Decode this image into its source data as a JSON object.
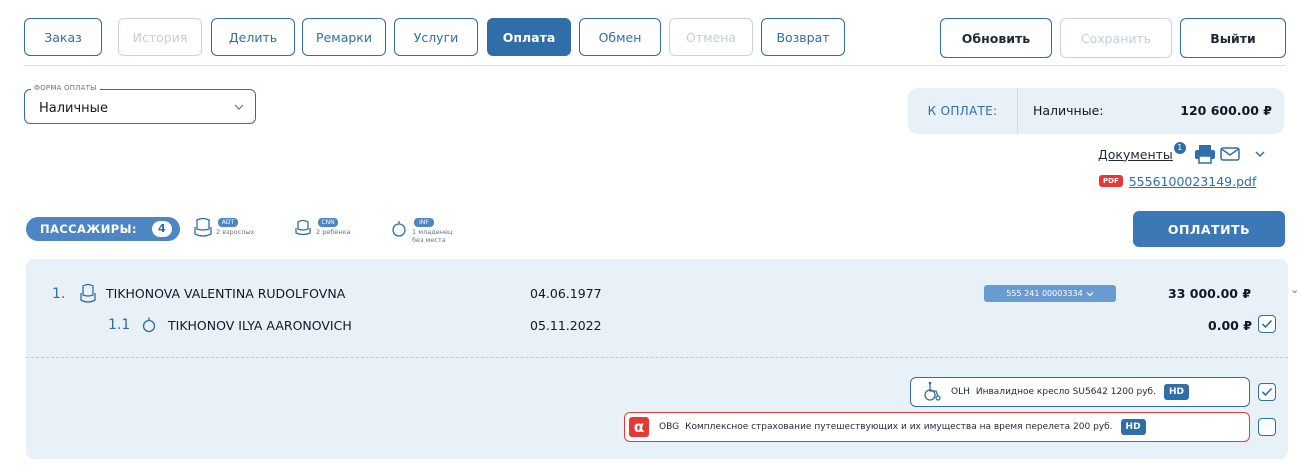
{
  "tabs": [
    {
      "label": "Заказ",
      "state": "normal"
    },
    {
      "label": "История",
      "state": "disabled"
    },
    {
      "label": "Делить",
      "state": "normal"
    },
    {
      "label": "Ремарки",
      "state": "normal"
    },
    {
      "label": "Услуги",
      "state": "normal"
    },
    {
      "label": "Оплата",
      "state": "active"
    },
    {
      "label": "Обмен",
      "state": "normal"
    },
    {
      "label": "Отмена",
      "state": "disabled"
    },
    {
      "label": "Возврат",
      "state": "normal"
    }
  ],
  "actions": {
    "refresh": "Обновить",
    "save": "Сохранить",
    "exit": "Выйти"
  },
  "payment_form": {
    "legend": "ФОРМА ОПЛАТЫ",
    "value": "Наличные"
  },
  "to_pay": {
    "label": "К ОПЛАТЕ:",
    "method": "Наличные:",
    "amount": "120 600.00 ₽"
  },
  "documents": {
    "label": "Документы",
    "count": "1",
    "pdf_tag": "PDF",
    "file": "5556100023149.pdf"
  },
  "passengers_bar": {
    "label": "ПАССАЖИРЫ:",
    "count": "4",
    "types": [
      {
        "tag": "ADT",
        "desc": "2 взрослых",
        "desc2": ""
      },
      {
        "tag": "CNN",
        "desc": "2 ребенка",
        "desc2": ""
      },
      {
        "tag": "INF",
        "desc": "1 младенец",
        "desc2": "без места"
      }
    ]
  },
  "pay_button": "ОПЛАТИТЬ",
  "passengers": [
    {
      "num": "1.",
      "name": "TIKHONOVA VALENTINA RUDOLFOVNA",
      "dob": "04.06.1977",
      "ticket": "555 241 00003334",
      "amount": "33 000.00 ₽",
      "checked": false
    },
    {
      "num": "1.1",
      "name": "TIKHONOV ILYA AARONOVICH",
      "dob": "05.11.2022",
      "amount": "0.00 ₽",
      "checked": true
    }
  ],
  "services": [
    {
      "code": "OLH",
      "text": "Инвалидное кресло  SU5642  1200 руб.",
      "badge": "HD",
      "checked": true
    },
    {
      "code": "OBG",
      "text": "Комплексное страхование путешествующих и их имущества на время перелета  200 руб.",
      "badge": "HD",
      "checked": false
    }
  ],
  "colors": {
    "accent": "#2f6ea6",
    "panel_bg": "#e8f0f8",
    "alfa_red": "#e53935"
  }
}
